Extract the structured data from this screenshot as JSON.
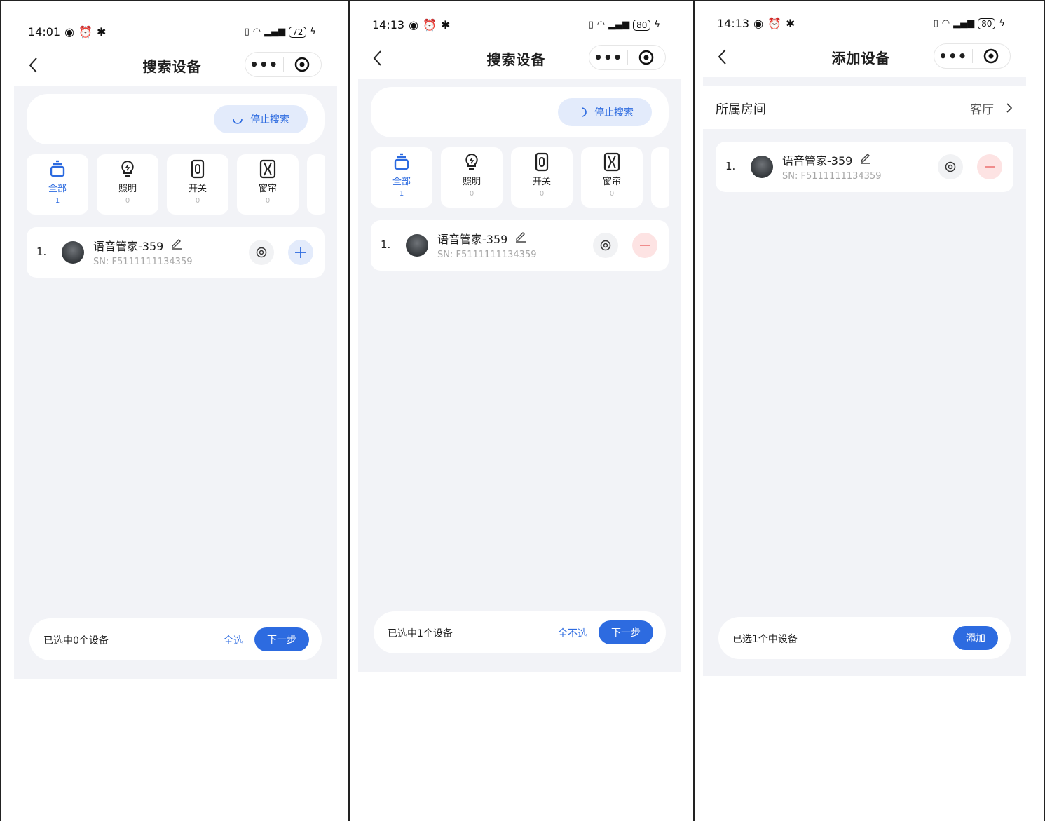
{
  "panels": [
    {
      "status": {
        "time": "14:01",
        "battery": "72"
      },
      "title": "搜索设备",
      "stop_search": "停止搜索",
      "categories": [
        {
          "label": "全部",
          "count": "1"
        },
        {
          "label": "照明",
          "count": "0"
        },
        {
          "label": "开关",
          "count": "0"
        },
        {
          "label": "窗帘",
          "count": "0"
        }
      ],
      "device": {
        "index": "1.",
        "name": "语音管家-359",
        "sn": "SN:  F5111111134359",
        "action": "add"
      },
      "bottom": {
        "selected_text": "已选中0个设备",
        "select_link": "全选",
        "next_button": "下一步"
      }
    },
    {
      "status": {
        "time": "14:13",
        "battery": "80"
      },
      "title": "搜索设备",
      "stop_search": "停止搜索",
      "categories": [
        {
          "label": "全部",
          "count": "1"
        },
        {
          "label": "照明",
          "count": "0"
        },
        {
          "label": "开关",
          "count": "0"
        },
        {
          "label": "窗帘",
          "count": "0"
        }
      ],
      "device": {
        "index": "1.",
        "name": "语音管家-359",
        "sn": "SN:  F5111111134359",
        "action": "remove"
      },
      "bottom": {
        "selected_text": "已选中1个设备",
        "select_link": "全不选",
        "next_button": "下一步"
      }
    },
    {
      "status": {
        "time": "14:13",
        "battery": "80"
      },
      "title": "添加设备",
      "room": {
        "label": "所属房间",
        "value": "客厅"
      },
      "device": {
        "index": "1.",
        "name": "语音管家-359",
        "sn": "SN:  F5111111134359",
        "action": "remove"
      },
      "bottom": {
        "selected_text": "已选1个中设备",
        "add_button": "添加"
      }
    }
  ],
  "colors": {
    "accent": "#2d6be0",
    "accent_light": "#e3ebfb",
    "danger": "#f08c8c",
    "danger_light": "#fde3e3",
    "page_bg": "#f2f3f7"
  },
  "icons": [
    "back-arrow-icon",
    "more-dots-icon",
    "target-icon",
    "spinner-icon",
    "all-devices-icon",
    "bulb-icon",
    "switch-icon",
    "curtain-icon",
    "edit-pencil-icon",
    "location-icon",
    "plus-icon",
    "minus-icon",
    "chevron-right-icon"
  ]
}
